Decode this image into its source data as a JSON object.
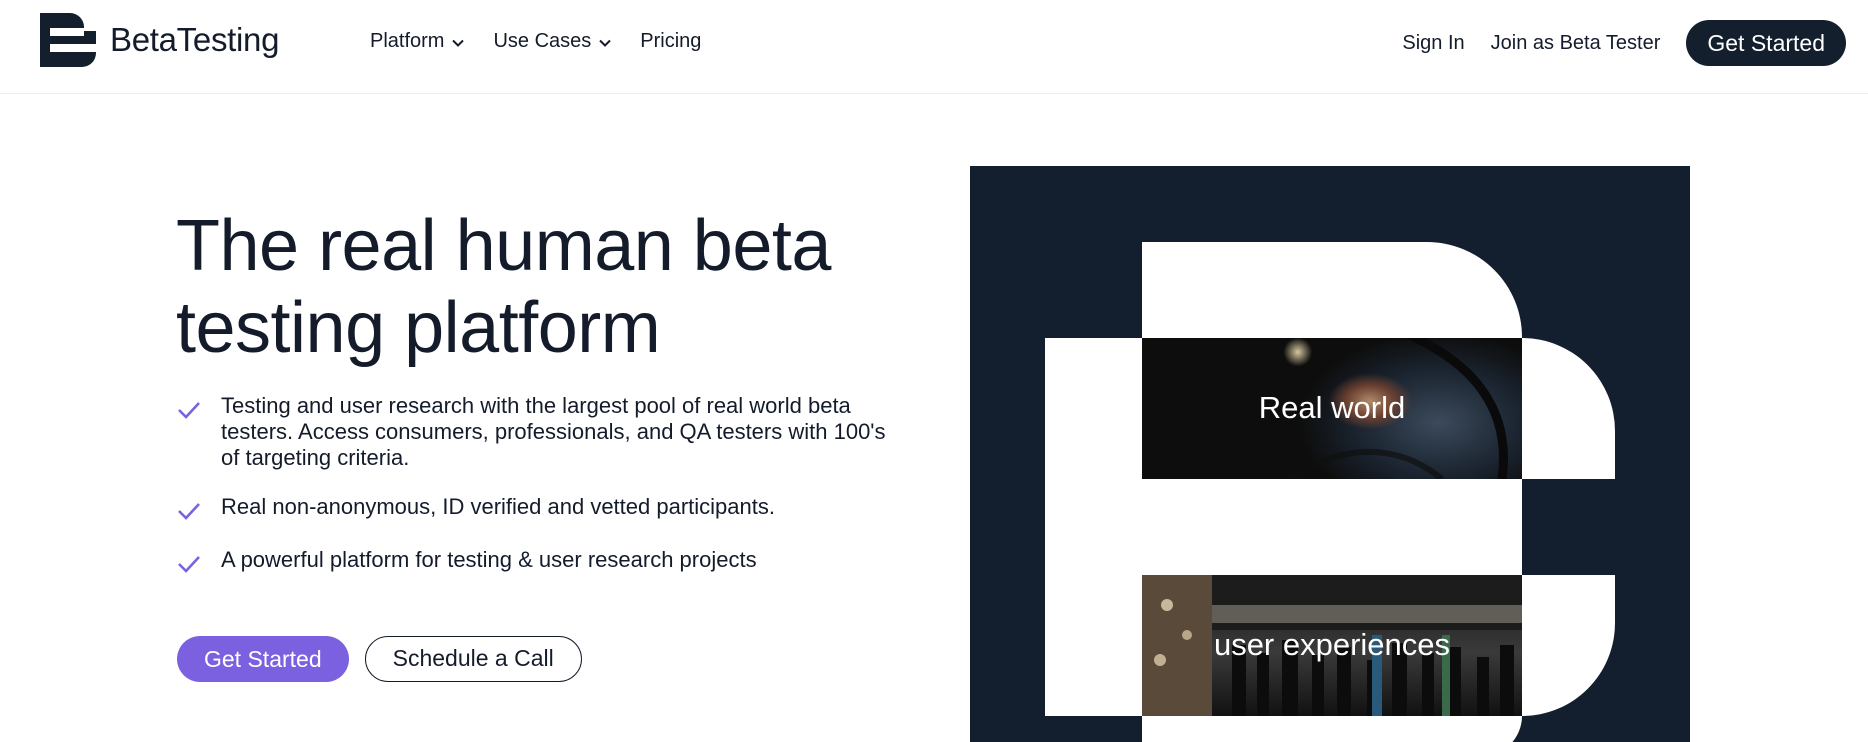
{
  "header": {
    "brand": "BetaTesting",
    "nav": [
      {
        "label": "Platform",
        "has_dropdown": true
      },
      {
        "label": "Use Cases",
        "has_dropdown": true
      },
      {
        "label": "Pricing",
        "has_dropdown": false
      }
    ],
    "sign_in": "Sign In",
    "join": "Join as Beta Tester",
    "get_started": "Get Started"
  },
  "hero": {
    "title_line1": "The real human beta",
    "title_line2": "testing platform",
    "bullets": [
      "Testing and user research with the largest pool of real world beta testers. Access consumers, professionals, and QA testers with 100's of targeting criteria.",
      "Real non-anonymous, ID verified and vetted participants.",
      "A powerful platform for testing & user research projects"
    ],
    "primary_cta": "Get Started",
    "secondary_cta": "Schedule a Call"
  },
  "graphic": {
    "photo1_label": "Real world",
    "photo2_label": "user experiences"
  },
  "colors": {
    "dark_navy": "#131f2e",
    "accent_purple": "#7b61e0",
    "check_purple": "#7b61e0",
    "text": "#141c2b"
  },
  "icons": {
    "logo": "betatesting-b-logo",
    "dropdown": "chevron-down-icon",
    "bullet": "check-icon"
  }
}
